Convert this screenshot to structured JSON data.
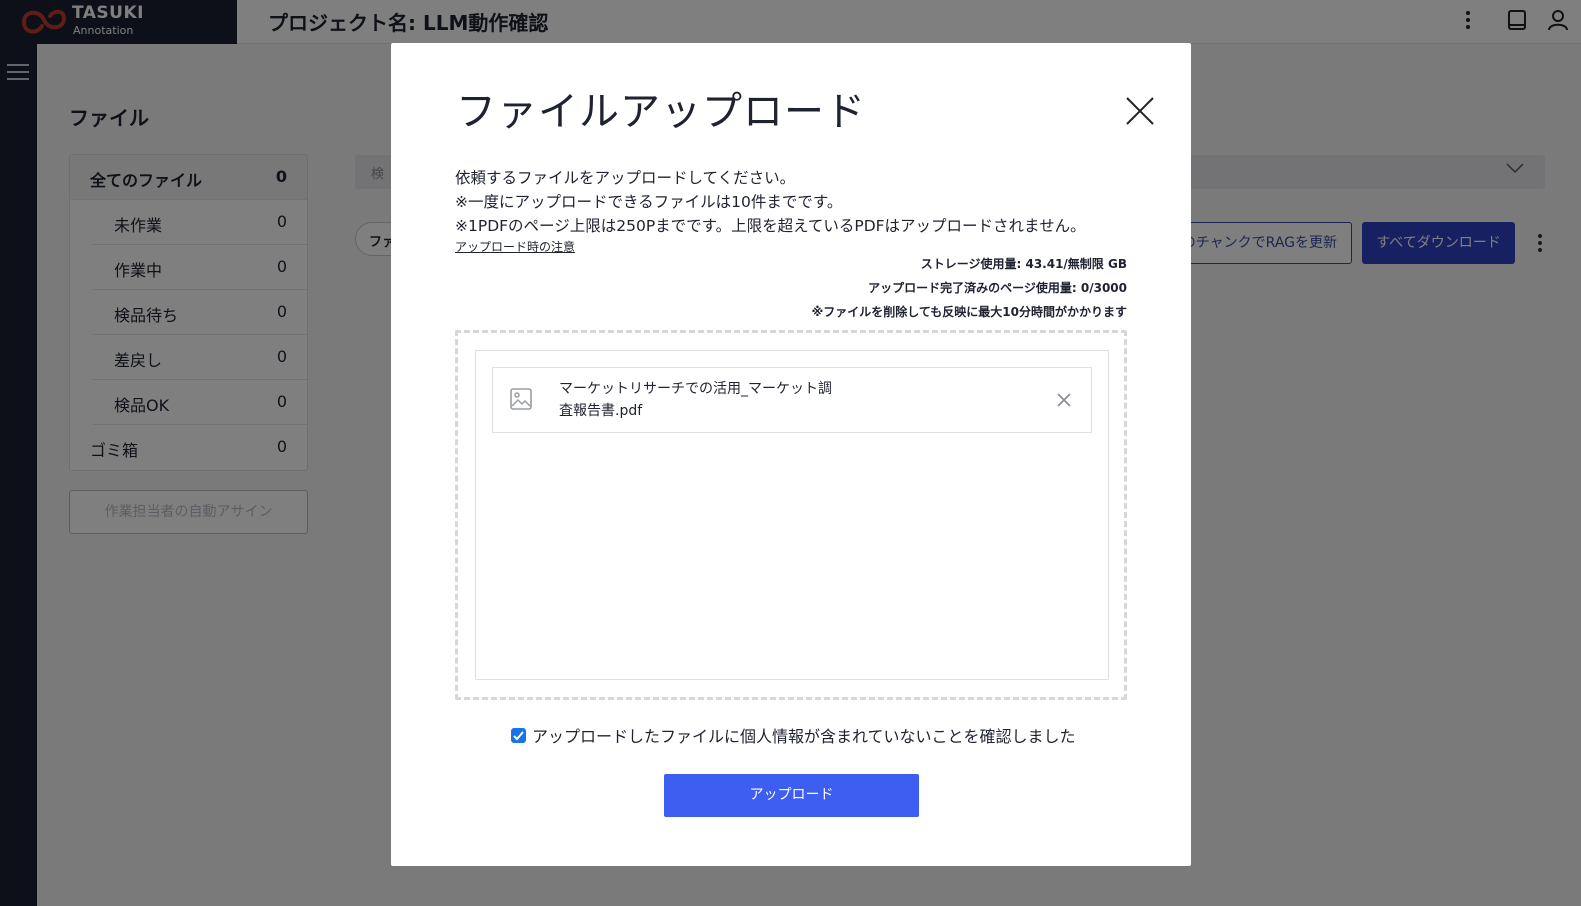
{
  "app": {
    "logo_line1": "TASUKI",
    "logo_line2": "Annotation",
    "project_title": "プロジェクト名: LLM動作確認"
  },
  "colors": {
    "primary_blue": "#3d5ef0",
    "dark_nav": "#1b2030",
    "checkbox_blue": "#1a73e8"
  },
  "top_icons": [
    "more-vertical-icon",
    "book-icon",
    "user-icon"
  ],
  "sidebar": {
    "heading": "ファイル",
    "items": [
      {
        "label": "全てのファイル",
        "count": "0"
      },
      {
        "label": "未作業",
        "count": "0"
      },
      {
        "label": "作業中",
        "count": "0"
      },
      {
        "label": "検品待ち",
        "count": "0"
      },
      {
        "label": "差戻し",
        "count": "0"
      },
      {
        "label": "検品OK",
        "count": "0"
      },
      {
        "label": "ゴミ箱",
        "count": "0"
      }
    ],
    "auto_assign_label": "作業担当者の自動アサイン"
  },
  "main": {
    "search_placeholder": "検",
    "filter_label": "ファ",
    "rag_button_label": "のチャンクでRAGを更新",
    "download_all_label": "すべてダウンロード"
  },
  "modal": {
    "title": "ファイルアップロード",
    "description_lines": [
      "依頼するファイルをアップロードしてください。",
      "※一度にアップロードできるファイルは10件までです。",
      "※1PDFのページ上限は250Pまでです。上限を超えているPDFはアップロードされません。"
    ],
    "notes_link": "アップロード時の注意",
    "storage_usage": "ストレージ使用量: 43.41/無制限 GB",
    "page_usage": "アップロード完了済みのページ使用量: 0/3000",
    "delete_note": "※ファイルを削除しても反映に最大10分時間がかかります",
    "files": [
      {
        "name_line1": "マーケットリサーチでの活用_マーケット調",
        "name_line2": "査報告書.pdf"
      }
    ],
    "confirm_checked": true,
    "confirm_label": "アップロードしたファイルに個人情報が含まれていないことを確認しました",
    "upload_button_label": "アップロード"
  }
}
